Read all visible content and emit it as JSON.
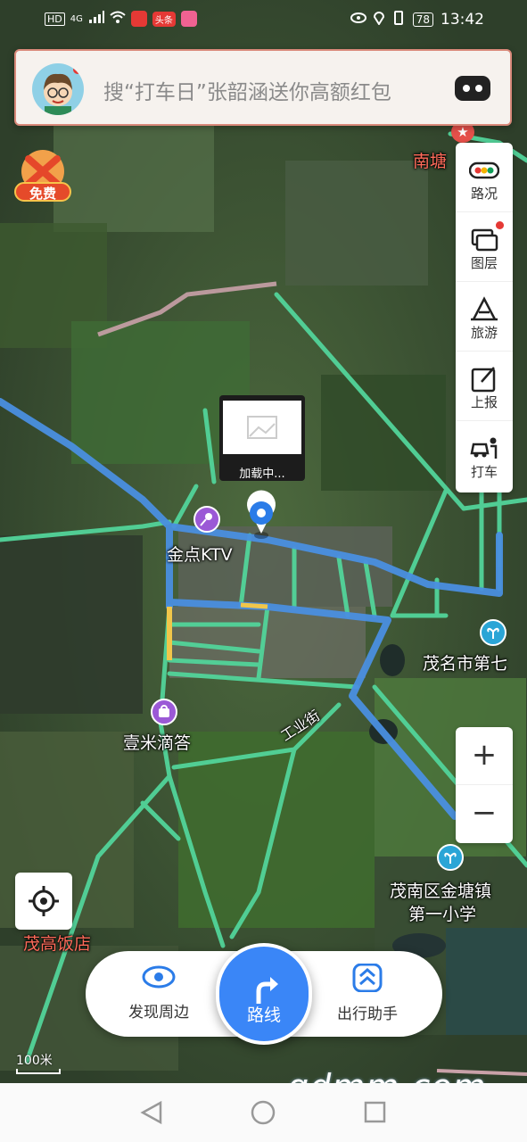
{
  "status_bar": {
    "left_icons": [
      "HD",
      "4G",
      "signal-icon",
      "wifi-icon",
      "mic-icon",
      "toutiao-icon",
      "app-icon"
    ],
    "hd": "HD",
    "network": "4G",
    "toutiao_badge": "头条",
    "battery": "78",
    "time": "13:42"
  },
  "search": {
    "placeholder": "搜“打车日”张韶涵送你高额红包"
  },
  "free_badge": {
    "label": "免费"
  },
  "toolbar": {
    "traffic": "路况",
    "layers": "图层",
    "travel": "旅游",
    "report": "上报",
    "taxi": "打车"
  },
  "zoom": {
    "in": "+",
    "out": "−"
  },
  "map_labels": {
    "nantang": "南塘",
    "ktv": "金点KTV",
    "maoming_school": "茂名市第七",
    "yimi": "壹米滴答",
    "road": "工业街",
    "jintang_school_line1": "茂南区金塘镇",
    "jintang_school_line2": "第一小学",
    "hotel": "茂高饭店"
  },
  "loading": "加载中...",
  "bottom_nav": {
    "discover": "发现周边",
    "route": "路线",
    "assistant": "出行助手"
  },
  "scale": "100米",
  "watermark": "gdmm.com",
  "colors": {
    "accent": "#3a86f7",
    "road_major": "#4a8fe0",
    "road_minor": "#52d49a",
    "search_border": "#d9897a"
  }
}
